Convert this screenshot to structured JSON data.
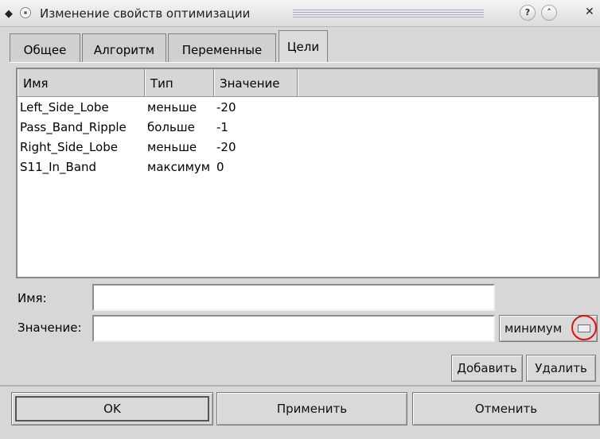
{
  "window": {
    "title": "Изменение свойств оптимизации"
  },
  "tabs": [
    {
      "label": "Общее"
    },
    {
      "label": "Алгоритм"
    },
    {
      "label": "Переменные"
    },
    {
      "label": "Цели"
    }
  ],
  "table": {
    "columns": [
      "Имя",
      "Тип",
      "Значение"
    ],
    "rows": [
      [
        "Left_Side_Lobe",
        "меньше",
        "-20"
      ],
      [
        "Pass_Band_Ripple",
        "больше",
        "-1"
      ],
      [
        "Right_Side_Lobe",
        "меньше",
        "-20"
      ],
      [
        "S11_In_Band",
        "максимум",
        "0"
      ]
    ]
  },
  "form": {
    "name_label": "Имя:",
    "value_label": "Значение:",
    "name_value": "",
    "value_value": "",
    "type_select": "минимум",
    "add_label": "Добавить",
    "delete_label": "Удалить"
  },
  "footer": {
    "ok_label": "OK",
    "apply_label": "Применить",
    "cancel_label": "Отменить"
  },
  "icons": [
    "app-icon",
    "menu-dot-icon",
    "help-icon",
    "shade-icon",
    "close-icon",
    "dropdown-indicator-icon"
  ]
}
